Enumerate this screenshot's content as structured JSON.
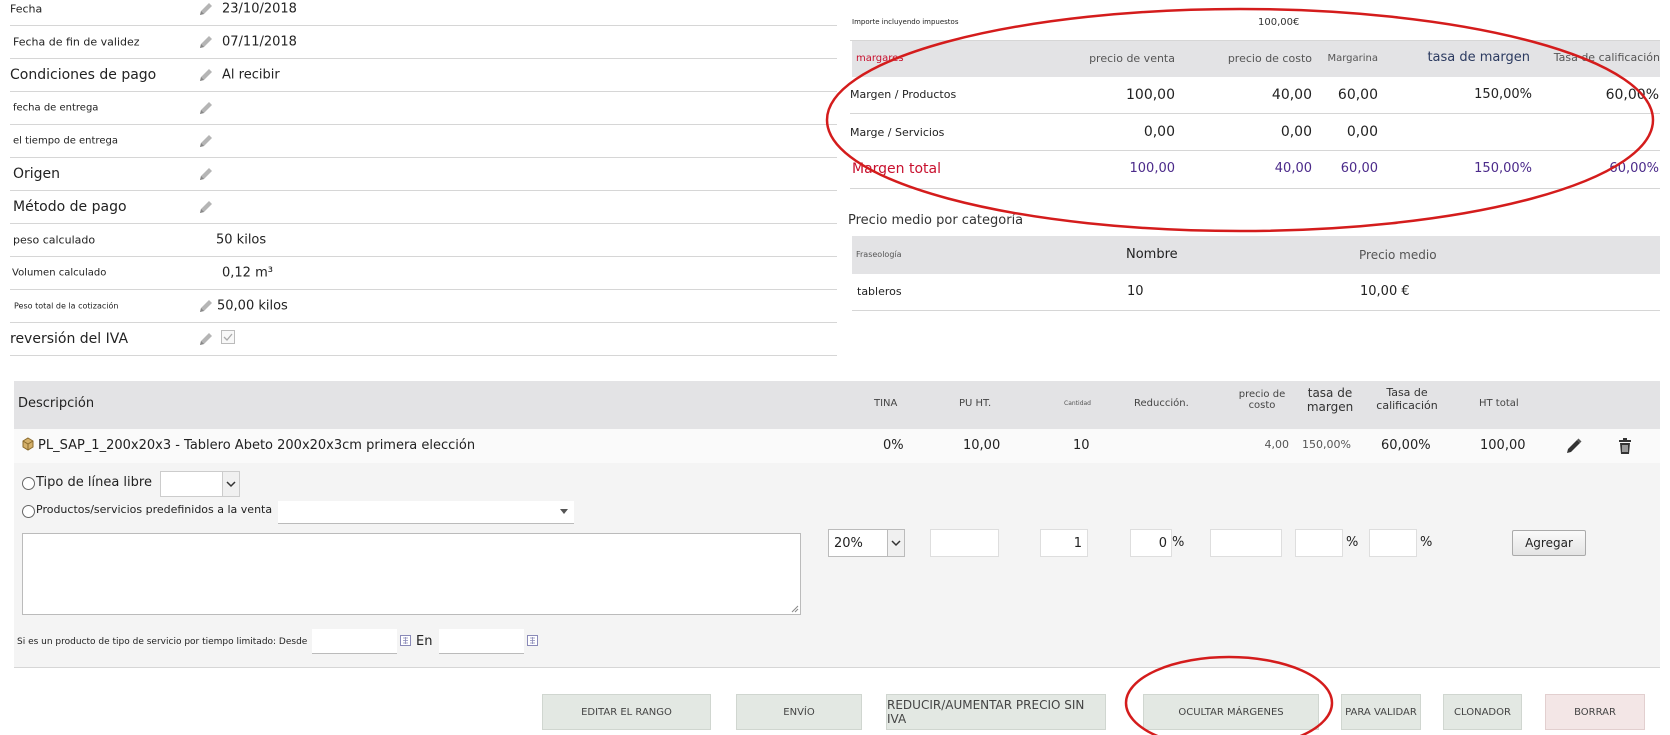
{
  "fields": [
    {
      "label": "Fecha",
      "value": "23/10/2018",
      "edit": true
    },
    {
      "label": "Fecha de fin de validez",
      "value": "07/11/2018",
      "edit": true
    },
    {
      "label": "Condiciones de pago",
      "value": "Al recibir",
      "edit": true
    },
    {
      "label": "fecha de entrega",
      "value": "",
      "edit": true
    },
    {
      "label": "el tiempo de entrega",
      "value": "",
      "edit": true
    },
    {
      "label": "Origen",
      "value": "",
      "edit": true
    },
    {
      "label": "Método de pago",
      "value": "",
      "edit": true
    },
    {
      "label": "peso calculado",
      "value": "50 kilos",
      "edit": false
    },
    {
      "label": "Volumen calculado",
      "value": "0,12 m³",
      "edit": false
    },
    {
      "label": "Peso total de la cotización",
      "value": "50,00 kilos",
      "edit": true
    },
    {
      "label": "reversión del IVA",
      "value": "",
      "edit": true,
      "checkbox": true
    }
  ],
  "totals": {
    "label": "Importe incluyendo impuestos",
    "value": "100,00€"
  },
  "margins": {
    "headers": [
      "margares",
      "precio de venta",
      "precio de costo",
      "Margarina",
      "tasa de margen",
      "Tasa de calificación"
    ],
    "rows": [
      [
        "Margen / Productos",
        "100,00",
        "40,00",
        "60,00",
        "150,00%",
        "60,00%"
      ],
      [
        "Marge / Servicios",
        "0,00",
        "0,00",
        "0,00",
        "",
        ""
      ]
    ],
    "total": [
      "Margen total",
      "100,00",
      "40,00",
      "60,00",
      "150,00%",
      "60,00%"
    ]
  },
  "avg_price": {
    "title": "Precio medio por categoría",
    "headers": [
      "Fraseología",
      "Nombre",
      "Precio medio"
    ],
    "row": [
      "tableros",
      "10",
      "10,00 €"
    ]
  },
  "lines": {
    "headers": {
      "desc": "Descripción",
      "vat": "TINA",
      "pu": "PU HT.",
      "qty": "Cantidad",
      "disc": "Reducción.",
      "cost": "precio de costo",
      "margin": "tasa de margen",
      "markup": "Tasa de calificación",
      "total": "HT total"
    },
    "item": {
      "desc": "PL_SAP_1_200x20x3 - Tablero Abeto 200x20x3cm primera elección",
      "vat": "0%",
      "pu": "10,00",
      "qty": "10",
      "cost": "4,00",
      "margin": "150,00%",
      "markup": "60,00%",
      "total": "100,00"
    }
  },
  "add_line": {
    "free_type": "Tipo de línea libre",
    "predefined": "Productos/servicios predefinidos a la venta",
    "vat": "20%",
    "qty": "1",
    "disc": "0",
    "pct": "%",
    "add_button": "Agregar",
    "service_text": "Si es un producto de tipo de servicio por tiempo limitado: Desde",
    "to_text": "En"
  },
  "actions": [
    "EDITAR EL RANGO",
    "ENVÍO",
    "REDUCIR/AUMENTAR PRECIO SIN IVA",
    "OCULTAR MÁRGENES",
    "PARA VALIDAR",
    "CLONADOR",
    "BORRAR"
  ],
  "colors": {
    "accent_red": "#c8102e",
    "total_purple": "#4b2a8a",
    "header_gray": "#e3e3e5",
    "button_green": "#e3e8e3",
    "delete_pink": "#f3e6e6"
  }
}
